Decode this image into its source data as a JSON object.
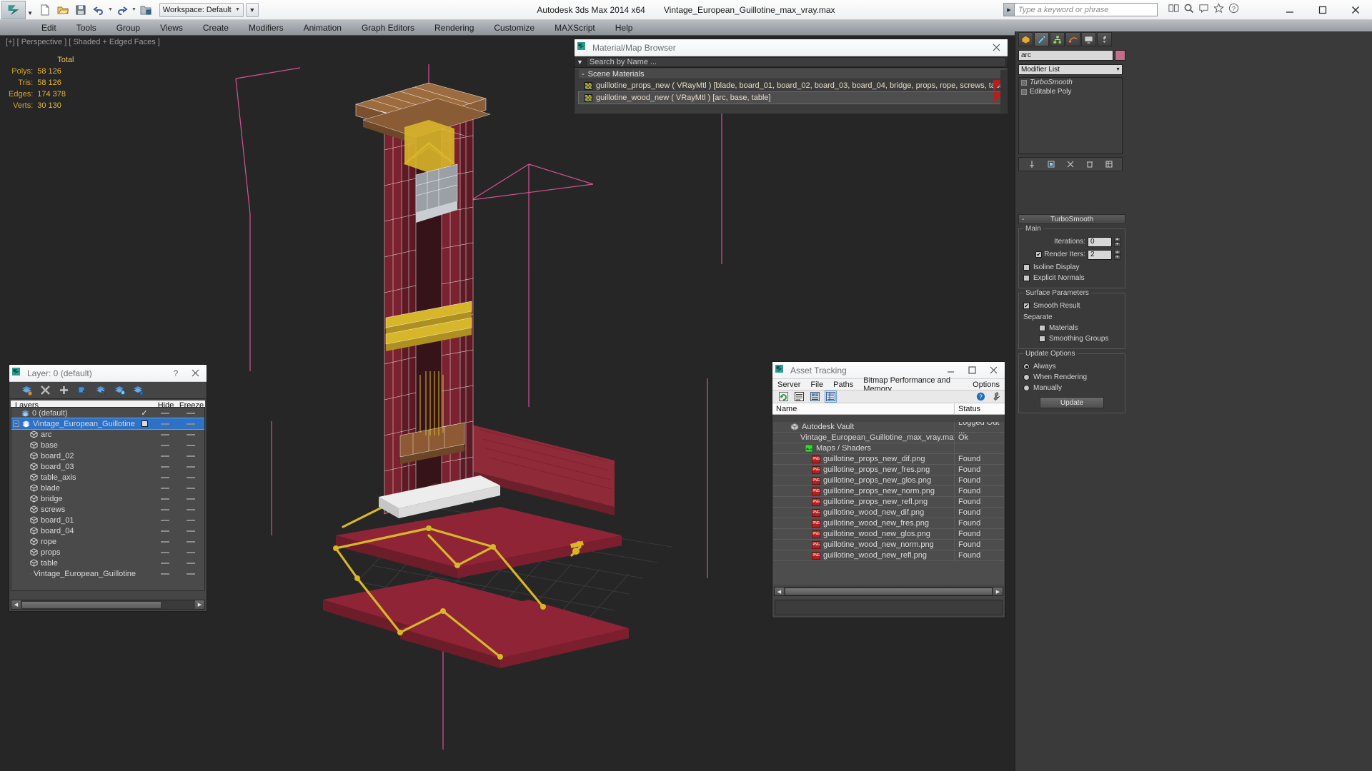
{
  "titlebar": {
    "workspace_label": "Workspace: Default",
    "app_title": "Autodesk 3ds Max  2014 x64",
    "file_title": "Vintage_European_Guillotine_max_vray.max",
    "search_placeholder": "Type a keyword or phrase",
    "quick_access": [
      {
        "name": "new-file-icon",
        "label": "New"
      },
      {
        "name": "open-file-icon",
        "label": "Open"
      },
      {
        "name": "save-file-icon",
        "label": "Save"
      },
      {
        "name": "undo-icon",
        "label": "Undo"
      },
      {
        "name": "redo-icon",
        "label": "Redo"
      },
      {
        "name": "set-project-folder-icon",
        "label": "Set Project Folder"
      }
    ],
    "window_buttons": [
      "minimize",
      "maximize",
      "close"
    ]
  },
  "menubar": {
    "items": [
      "Edit",
      "Tools",
      "Group",
      "Views",
      "Create",
      "Modifiers",
      "Animation",
      "Graph Editors",
      "Rendering",
      "Customize",
      "MAXScript",
      "Help"
    ]
  },
  "viewport": {
    "label": "[+] [ Perspective ] [ Shaded + Edged Faces ]",
    "stats": {
      "header": "Total",
      "rows": [
        {
          "label": "Polys:",
          "value": "58 126"
        },
        {
          "label": "Tris:",
          "value": "58 126"
        },
        {
          "label": "Edges:",
          "value": "174 378"
        },
        {
          "label": "Verts:",
          "value": "30 130"
        }
      ]
    }
  },
  "material_browser": {
    "title": "Material/Map Browser",
    "search_placeholder": "Search by Name ...",
    "group_label": "Scene Materials",
    "materials": [
      {
        "name": "guillotine_props_new ( VRayMtl ) [blade, board_01, board_02, board_03, board_04, bridge, props, rope, screws, table_axis]",
        "selected": false
      },
      {
        "name": "guillotine_wood_new ( VRayMtl ) [arc, base, table]",
        "selected": true
      }
    ]
  },
  "layer_dialog": {
    "title": "Layer: 0 (default)",
    "help_label": "?",
    "toolbar": [
      {
        "name": "create-new-layer-icon",
        "label": "Create New Layer"
      },
      {
        "name": "delete-highlighted-empty-layers-icon",
        "label": "Delete Layer"
      },
      {
        "name": "add-selected-objects-icon",
        "label": "Add Selected Objects to Layer"
      },
      {
        "name": "select-objects-in-layer-icon",
        "label": "Select Objects in Current Layer"
      },
      {
        "name": "set-current-layer-to-selection-icon",
        "label": "Set Current Layer to Selection"
      },
      {
        "name": "select-highlighted-objects-icon",
        "label": "Select Highlighted Objects and Layers"
      },
      {
        "name": "highlight-selected-objects-icon",
        "label": "Highlight Selected Objects Layers"
      }
    ],
    "columns": [
      "Layers",
      "",
      "Hide",
      "Freeze"
    ],
    "rows": [
      {
        "label": "0 (default)",
        "indent": 0,
        "icon": "layer-icon",
        "expand": "",
        "toggle": "check",
        "hide": "dash",
        "freeze": "dash",
        "selected": false
      },
      {
        "label": "Vintage_European_Guillotine",
        "indent": 0,
        "icon": "layer-icon",
        "expand": "minus",
        "toggle": "box",
        "hide": "dash",
        "freeze": "dash",
        "selected": true
      },
      {
        "label": "arc",
        "indent": 1,
        "icon": "object-icon",
        "expand": "",
        "toggle": "",
        "hide": "dash",
        "freeze": "dash",
        "selected": false
      },
      {
        "label": "base",
        "indent": 1,
        "icon": "object-icon",
        "expand": "",
        "toggle": "",
        "hide": "dash",
        "freeze": "dash",
        "selected": false
      },
      {
        "label": "board_02",
        "indent": 1,
        "icon": "object-icon",
        "expand": "",
        "toggle": "",
        "hide": "dash",
        "freeze": "dash",
        "selected": false
      },
      {
        "label": "board_03",
        "indent": 1,
        "icon": "object-icon",
        "expand": "",
        "toggle": "",
        "hide": "dash",
        "freeze": "dash",
        "selected": false
      },
      {
        "label": "table_axis",
        "indent": 1,
        "icon": "object-icon",
        "expand": "",
        "toggle": "",
        "hide": "dash",
        "freeze": "dash",
        "selected": false
      },
      {
        "label": "blade",
        "indent": 1,
        "icon": "object-icon",
        "expand": "",
        "toggle": "",
        "hide": "dash",
        "freeze": "dash",
        "selected": false
      },
      {
        "label": "bridge",
        "indent": 1,
        "icon": "object-icon",
        "expand": "",
        "toggle": "",
        "hide": "dash",
        "freeze": "dash",
        "selected": false
      },
      {
        "label": "screws",
        "indent": 1,
        "icon": "object-icon",
        "expand": "",
        "toggle": "",
        "hide": "dash",
        "freeze": "dash",
        "selected": false
      },
      {
        "label": "board_01",
        "indent": 1,
        "icon": "object-icon",
        "expand": "",
        "toggle": "",
        "hide": "dash",
        "freeze": "dash",
        "selected": false
      },
      {
        "label": "board_04",
        "indent": 1,
        "icon": "object-icon",
        "expand": "",
        "toggle": "",
        "hide": "dash",
        "freeze": "dash",
        "selected": false
      },
      {
        "label": "rope",
        "indent": 1,
        "icon": "object-icon",
        "expand": "",
        "toggle": "",
        "hide": "dash",
        "freeze": "dash",
        "selected": false
      },
      {
        "label": "props",
        "indent": 1,
        "icon": "object-icon",
        "expand": "",
        "toggle": "",
        "hide": "dash",
        "freeze": "dash",
        "selected": false
      },
      {
        "label": "table",
        "indent": 1,
        "icon": "object-icon",
        "expand": "",
        "toggle": "",
        "hide": "dash",
        "freeze": "dash",
        "selected": false
      },
      {
        "label": "Vintage_European_Guillotine",
        "indent": 1,
        "icon": "object-icon",
        "expand": "",
        "toggle": "",
        "hide": "dash",
        "freeze": "dash",
        "selected": false
      }
    ]
  },
  "asset_tracking": {
    "title": "Asset Tracking",
    "menu": [
      "Server",
      "File",
      "Paths",
      "Bitmap Performance and Memory",
      "Options"
    ],
    "columns": [
      "Name",
      "Status"
    ],
    "rows": [
      {
        "name": "Autodesk Vault",
        "status": "Logged Out ...",
        "icon": "vault-icon",
        "indent": 1
      },
      {
        "name": "Vintage_European_Guillotine_max_vray.max",
        "status": "Ok",
        "icon": "max-file-icon",
        "indent": 2
      },
      {
        "name": "Maps / Shaders",
        "status": "",
        "icon": "maps-shaders-icon",
        "indent": 3
      },
      {
        "name": "guillotine_props_new_dif.png",
        "status": "Found",
        "icon": "png-icon",
        "indent": 4
      },
      {
        "name": "guillotine_props_new_fres.png",
        "status": "Found",
        "icon": "png-icon",
        "indent": 4
      },
      {
        "name": "guillotine_props_new_glos.png",
        "status": "Found",
        "icon": "png-icon",
        "indent": 4
      },
      {
        "name": "guillotine_props_new_norm.png",
        "status": "Found",
        "icon": "png-icon",
        "indent": 4
      },
      {
        "name": "guillotine_props_new_refl.png",
        "status": "Found",
        "icon": "png-icon",
        "indent": 4
      },
      {
        "name": "guillotine_wood_new_dif.png",
        "status": "Found",
        "icon": "png-icon",
        "indent": 4
      },
      {
        "name": "guillotine_wood_new_fres.png",
        "status": "Found",
        "icon": "png-icon",
        "indent": 4
      },
      {
        "name": "guillotine_wood_new_glos.png",
        "status": "Found",
        "icon": "png-icon",
        "indent": 4
      },
      {
        "name": "guillotine_wood_new_norm.png",
        "status": "Found",
        "icon": "png-icon",
        "indent": 4
      },
      {
        "name": "guillotine_wood_new_refl.png",
        "status": "Found",
        "icon": "png-icon",
        "indent": 4
      }
    ]
  },
  "command_panel": {
    "tabs": [
      {
        "name": "create-tab",
        "label": "Create"
      },
      {
        "name": "modify-tab",
        "label": "Modify"
      },
      {
        "name": "hierarchy-tab",
        "label": "Hierarchy"
      },
      {
        "name": "motion-tab",
        "label": "Motion"
      },
      {
        "name": "display-tab",
        "label": "Display"
      },
      {
        "name": "utilities-tab",
        "label": "Utilities"
      }
    ],
    "object_name": "arc",
    "object_color": "#c36d8a",
    "modifier_list_label": "Modifier List",
    "modifier_stack": [
      {
        "label": "TurboSmooth",
        "italic": true
      },
      {
        "label": "Editable Poly",
        "italic": false
      }
    ],
    "rollout_title": "TurboSmooth",
    "main_group": "Main",
    "iterations_label": "Iterations:",
    "iterations_value": "0",
    "render_iters_label": "Render Iters:",
    "render_iters_value": "2",
    "render_iters_checked": true,
    "isoline_display_label": "Isoline Display",
    "isoline_display_checked": false,
    "explicit_normals_label": "Explicit Normals",
    "explicit_normals_checked": false,
    "surface_params_group": "Surface Parameters",
    "smooth_result_label": "Smooth Result",
    "smooth_result_checked": true,
    "separate_label": "Separate",
    "materials_label": "Materials",
    "materials_checked": false,
    "smoothing_groups_label": "Smoothing Groups",
    "smoothing_groups_checked": false,
    "update_options_group": "Update Options",
    "update_always_label": "Always",
    "update_when_rendering_label": "When Rendering",
    "update_manually_label": "Manually",
    "update_selected": "Always",
    "update_button_label": "Update"
  },
  "colors": {
    "accent_blue": "#2e72c8",
    "viewport_bg": "#262626",
    "stats_yellow": "#e8b63c",
    "panel_bg": "#3a3a3a"
  }
}
